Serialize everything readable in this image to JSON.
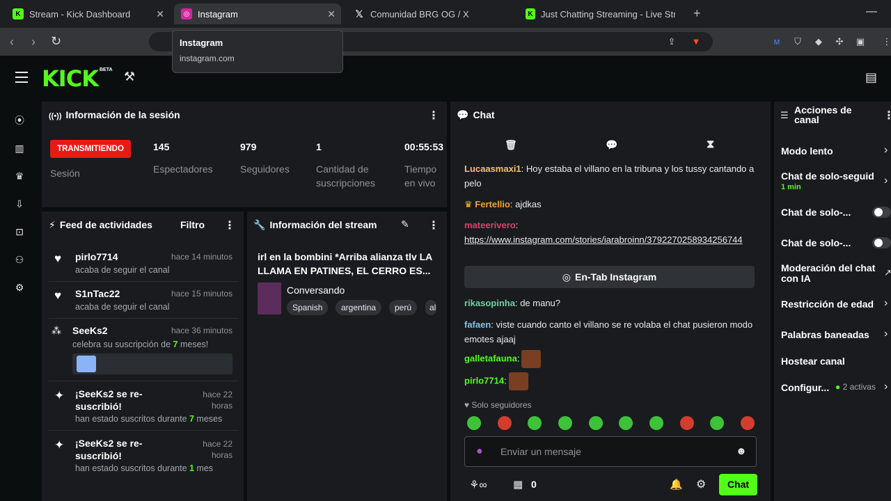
{
  "browser": {
    "tabs": [
      {
        "title": "Stream - Kick Dashboard",
        "active": false
      },
      {
        "title": "Instagram",
        "active": true
      },
      {
        "title": "Comunidad BRG OG / X",
        "active": false
      },
      {
        "title": "Just Chatting Streaming - Live Stream",
        "active": false
      }
    ],
    "tooltip": {
      "title": "Instagram",
      "url": "instagram.com"
    }
  },
  "kick": {
    "logo": "KICK",
    "beta": "BETA"
  },
  "session": {
    "title": "Información de la sesión",
    "status": "TRANSMITIENDO",
    "status_label": "Sesión",
    "stats": [
      {
        "value": "145",
        "label": "Espectadores"
      },
      {
        "value": "979",
        "label": "Seguidores"
      },
      {
        "value": "1",
        "label": "Cantidad de suscripciones"
      },
      {
        "value": "00:55:53",
        "label": "Tiempo en vivo"
      }
    ]
  },
  "feed": {
    "title": "Feed de actividades",
    "filter": "Filtro",
    "items": [
      {
        "name": "pirlo7714",
        "time": "hace 14 minutos",
        "desc": "acaba de seguir el canal"
      },
      {
        "name": "S1nTac22",
        "time": "hace 15 minutos",
        "desc": "acaba de seguir el canal"
      },
      {
        "name": "SeeKs2",
        "time": "hace 36 minutos",
        "desc_pre": "celebra su suscripción de ",
        "desc_num": "7",
        "desc_post": " meses!"
      },
      {
        "name": "¡SeeKs2 se re-suscribió!",
        "time": "hace 22 horas",
        "desc_pre": "han estado suscritos durante ",
        "desc_num": "7",
        "desc_post": " meses"
      },
      {
        "name": "¡SeeKs2 se re-suscribió!",
        "time": "hace 22 horas",
        "desc_pre": "han estado suscritos durante ",
        "desc_num": "1",
        "desc_post": " mes"
      }
    ]
  },
  "stream_info": {
    "title": "Información del stream",
    "stream_title": "irl en la bombini *Arriba alianza tlv LA LLAMA EN PATINES, EL CERRO ES...",
    "category": "Conversando",
    "tags": [
      "Spanish",
      "argentina",
      "perú",
      "al"
    ]
  },
  "chat": {
    "title": "Chat",
    "messages": [
      {
        "user": "Lucaasmaxi1",
        "color": "#f5c26b",
        "text": ": Hoy estaba el villano en la tribuna y los tussy cantando a pelo"
      },
      {
        "user": "Fertellio",
        "color": "#f0a030",
        "text": ": ajdkas"
      },
      {
        "user": "mateerivero",
        "color": "#e0406a",
        "text": ":"
      },
      {
        "user": "",
        "color": "#ffffff",
        "text": "https://www.instagram.com/stories/iarabroinn/3792270258934256744"
      },
      {
        "user": "rikasopinha",
        "color": "#6fd39a",
        "text": ": de manu?"
      },
      {
        "user": "fafaen",
        "color": "#7fc4e8",
        "text": ": viste cuando canto el villano se re volaba el chat pusieron modo emotes ajaaj"
      },
      {
        "user": "galletafauna",
        "color": "#53fc18",
        "text": ":"
      },
      {
        "user": "pirlo7714",
        "color": "#53fc18",
        "text": ":"
      }
    ],
    "open_button": "En-Tab Instagram",
    "followers_only": "Solo seguidores",
    "input_placeholder": "Enviar un mensaje",
    "points": "0",
    "send": "Chat"
  },
  "actions": {
    "title": "Acciones de canal",
    "items": [
      {
        "label": "Modo lento"
      },
      {
        "label": "Chat de solo-seguid",
        "sub": "1 min"
      },
      {
        "label": "Chat de solo-..."
      },
      {
        "label": "Chat de solo-..."
      },
      {
        "label": "Moderación del chat con IA"
      },
      {
        "label": "Restricción de edad"
      },
      {
        "label": "Palabras baneadas"
      },
      {
        "label": "Hostear canal"
      },
      {
        "label": "Configur...",
        "sub": "2 activas"
      }
    ]
  }
}
